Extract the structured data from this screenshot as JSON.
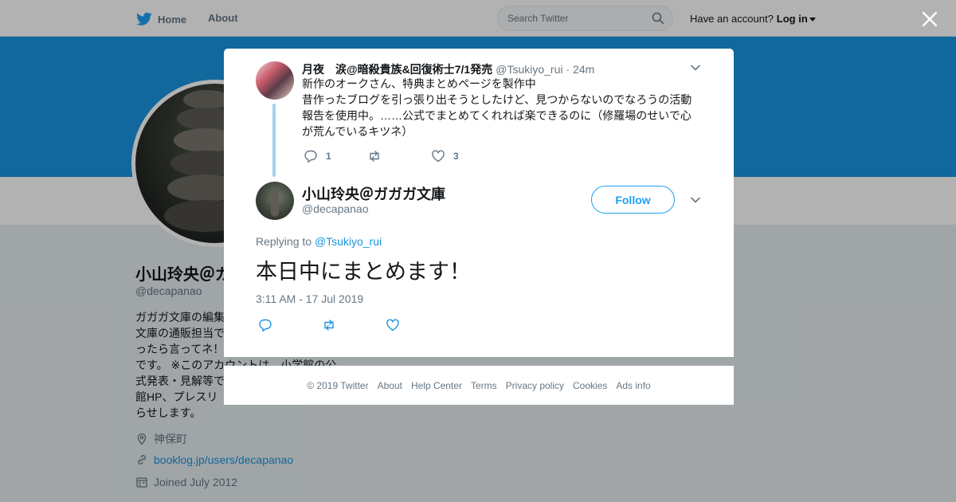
{
  "nav": {
    "home_label": "Home",
    "about_label": "About",
    "search_placeholder": "Search Twitter",
    "account_prompt": "Have an account?",
    "login_label": "Log in"
  },
  "profile": {
    "name": "小山玲央＠ガ",
    "handle": "@decapanao",
    "bio": "ガガガ文庫の編集\n文庫の通販担当で\nったら言ってネ！\nです。 ※このアカウントは、小学館の公\n式発表・見解等で\n館HP、プレスリ\nらせします。",
    "location": "神保町",
    "url": "booklog.jp/users/decapanao",
    "joined": "Joined July 2012"
  },
  "parent_tweet": {
    "name": "月夜　涙@暗殺貴族&回復術士7/1発売",
    "handle": "@Tsukiyo_rui",
    "time": "· 24m",
    "text": "新作のオークさん、特典まとめページを製作中\n昔作ったブログを引っ張り出そうとしたけど、見つからないのでなろうの活動報告を使用中。……公式でまとめてくれれば楽できるのに（修羅場のせいで心が荒んでいるキツネ）",
    "reply_count": "1",
    "retweet_count": "",
    "like_count": "3"
  },
  "main_tweet": {
    "name": "小山玲央＠ガガガ文庫",
    "handle": "@decapanao",
    "follow_label": "Follow",
    "replying_prefix": "Replying to",
    "replying_to": "@Tsukiyo_rui",
    "text": "本日中にまとめます！",
    "timestamp": "3:11 AM - 17 Jul 2019"
  },
  "footer": {
    "copyright": "© 2019 Twitter",
    "links": [
      "About",
      "Help Center",
      "Terms",
      "Privacy policy",
      "Cookies",
      "Ads info"
    ]
  },
  "colors": {
    "brand_blue": "#1da1f2",
    "link_blue": "#1b95e0",
    "thread_line": "#a2d2f3",
    "muted_text": "#657786"
  },
  "icons": [
    "twitter-bird-icon",
    "search-icon",
    "close-icon",
    "chevron-down-icon",
    "reply-icon",
    "retweet-icon",
    "heart-icon",
    "location-icon",
    "link-icon",
    "calendar-icon"
  ]
}
